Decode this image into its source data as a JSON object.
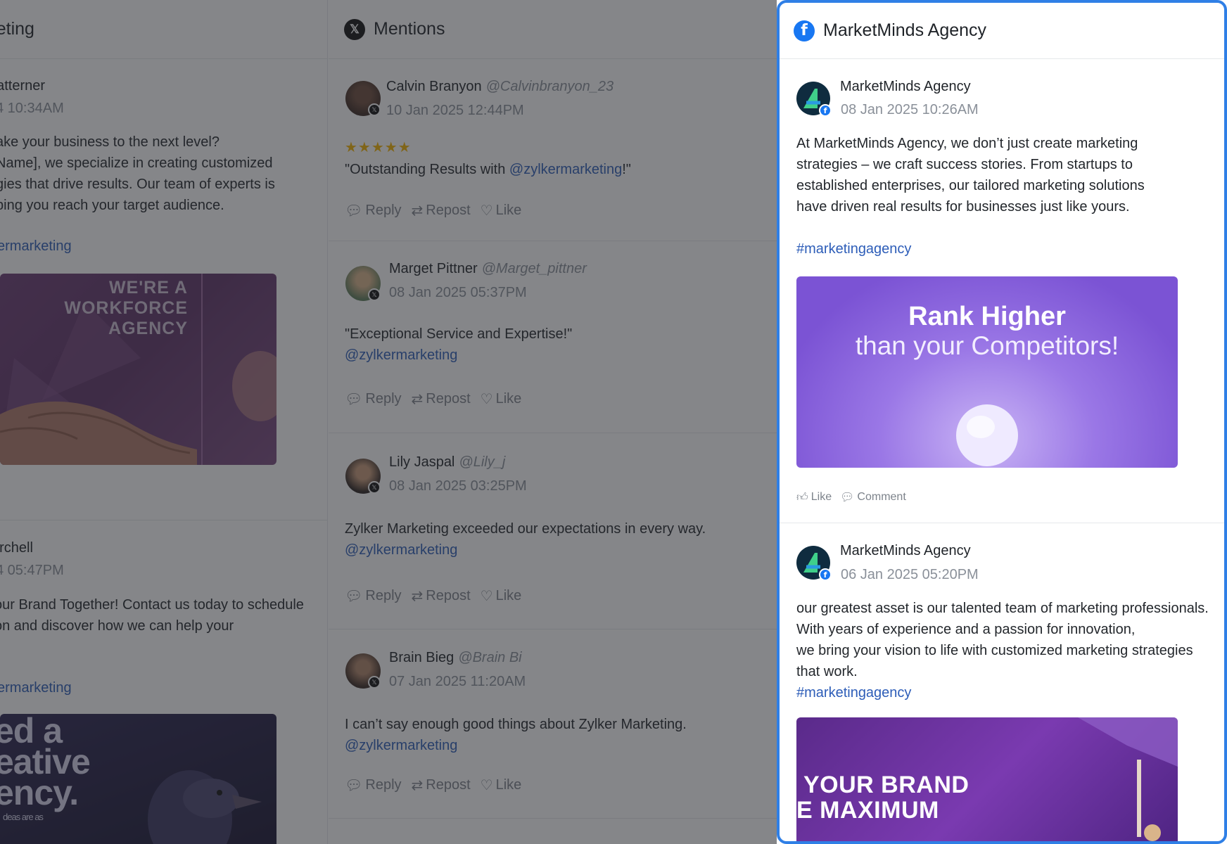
{
  "left_column": {
    "title": "arketing",
    "posts": [
      {
        "author": "Latterner",
        "time": "4 10:34AM",
        "lines": [
          "ake your business to the next level?",
          "Name], we specialize in creating customized",
          "gies that drive results. Our team of experts is",
          "bing you reach your target audience."
        ],
        "tag": "ermarketing",
        "image_text": [
          "WE'RE A",
          "WORKFORCE",
          "AGENCY"
        ]
      },
      {
        "author": "urchell",
        "time": "4 05:47PM",
        "lines": [
          "our Brand Together! Contact us today to schedule",
          "on and discover how we can help your"
        ],
        "tag": "ermarketing",
        "image_text": [
          "ed a",
          "eative",
          "ency.",
          "deas are as"
        ]
      }
    ]
  },
  "mentions": {
    "title": "Mentions",
    "posts": [
      {
        "author": "Calvin Branyon",
        "handle": "@Calvinbranyon_23",
        "time": "10 Jan 2025 12:44PM",
        "stars": "★★★★★",
        "text_before": "\"Outstanding Results with ",
        "text_link": "@zylkermarketing",
        "text_after": "!\"",
        "actions": {
          "reply": "Reply",
          "repost": "Repost",
          "like": "Like"
        }
      },
      {
        "author": "Marget Pittner",
        "handle": "@Marget_pittner",
        "time": "08 Jan 2025 05:37PM",
        "text": "\"Exceptional Service and Expertise!\"",
        "text_link": "@zylkermarketing",
        "actions": {
          "reply": "Reply",
          "repost": "Repost",
          "like": "Like"
        }
      },
      {
        "author": "Lily Jaspal",
        "handle": "@Lily_j",
        "time": "08 Jan 2025 03:25PM",
        "text": "Zylker Marketing exceeded our expectations in every way.",
        "text_link": "@zylkermarketing",
        "actions": {
          "reply": "Reply",
          "repost": "Repost",
          "like": "Like"
        }
      },
      {
        "author": "Brain Bieg",
        "handle": "@Brain Bi",
        "time": "07 Jan 2025 11:20AM",
        "text": "I can’t say enough good things about Zylker Marketing.",
        "text_link": "@zylkermarketing",
        "actions": {
          "reply": "Reply",
          "repost": "Repost",
          "like": "Like"
        }
      }
    ]
  },
  "facebook": {
    "title": "MarketMinds Agency",
    "posts": [
      {
        "author": "MarketMinds Agency",
        "time": "08 Jan 2025 10:26AM",
        "lines": [
          "At MarketMinds Agency, we don’t just create marketing",
          "strategies – we craft success stories. From startups to",
          "established enterprises, our tailored marketing solutions",
          "have driven real results for businesses just like yours."
        ],
        "tag": "#marketingagency",
        "image_title": "Rank Higher",
        "image_subtitle": "than your Competitors!",
        "actions": {
          "like": "Like",
          "comment": "Comment"
        }
      },
      {
        "author": "MarketMinds Agency",
        "time": "06 Jan 2025 05:20PM",
        "lines": [
          "our greatest asset is our talented team of marketing professionals.",
          "With years of experience and a passion for innovation,",
          "we bring your vision to life with customized marketing strategies",
          "that work."
        ],
        "tag": "#marketingagency",
        "image_text": [
          "YOUR BRAND",
          "E MAXIMUM"
        ]
      }
    ]
  },
  "colors": {
    "accent_border": "#2f7fe6",
    "link": "#2d5db8",
    "facebook_blue": "#1877f2",
    "overlay": "rgba(38,40,44,0.56)"
  }
}
